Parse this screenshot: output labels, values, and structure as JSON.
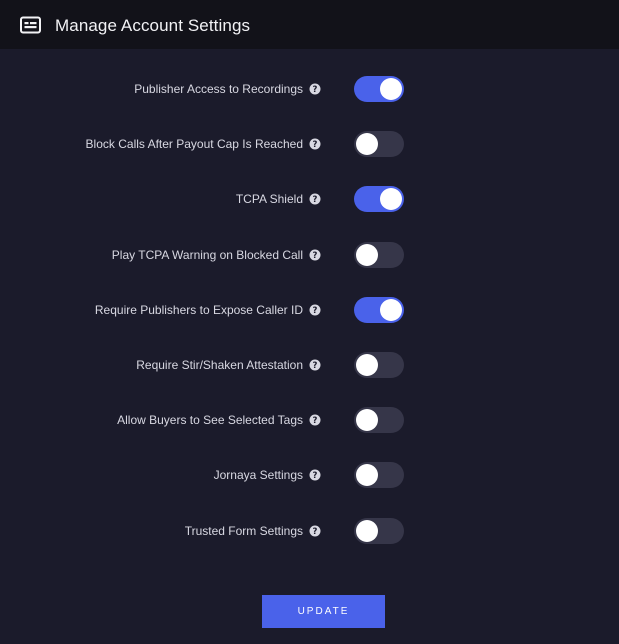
{
  "header": {
    "title": "Manage Account Settings",
    "icon": "id-card-icon"
  },
  "settings": [
    {
      "label": "Publisher Access to Recordings",
      "enabled": true
    },
    {
      "label": "Block Calls After Payout Cap Is Reached",
      "enabled": false
    },
    {
      "label": "TCPA Shield",
      "enabled": true
    },
    {
      "label": "Play TCPA Warning on Blocked Call",
      "enabled": false
    },
    {
      "label": "Require Publishers to Expose Caller ID",
      "enabled": true
    },
    {
      "label": "Require Stir/Shaken Attestation",
      "enabled": false
    },
    {
      "label": "Allow Buyers to See Selected Tags",
      "enabled": false
    },
    {
      "label": "Jornaya Settings",
      "enabled": false
    },
    {
      "label": "Trusted Form Settings",
      "enabled": false
    }
  ],
  "actions": {
    "update_label": "UPDATE"
  },
  "colors": {
    "background": "#1b1b2b",
    "header_background": "#121219",
    "accent": "#4a62ea",
    "toggle_off": "#363649"
  }
}
